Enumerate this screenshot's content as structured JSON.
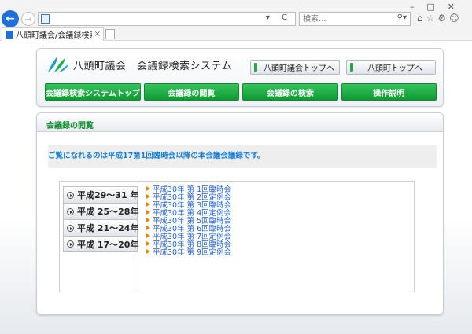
{
  "browser": {
    "tab_title": "八頭町議会/会議録検索シス...",
    "search_placeholder": "検索...",
    "address_tools": "▾ C"
  },
  "header": {
    "title": "八頭町議会　会議録検索システム",
    "top_links": [
      "八頭町議会トップへ",
      "八頭町トップへ"
    ],
    "menu": [
      "会議録検索システムトップ",
      "会議録の閲覧",
      "会議録の検索",
      "操作説明"
    ]
  },
  "content": {
    "section_title": "会議録の閲覧",
    "notice": "ご覧になれるのは平成17第1回臨時会以降の本会議会議録です。",
    "eras": [
      "平成29～31 年",
      "平成 25～28年",
      "平成 21～24年",
      "平成 17～20年"
    ],
    "meetings": [
      "平成30年 第 1回臨時会",
      "平成30年 第 2回定例会",
      "平成30年 第 3回臨時会",
      "平成30年 第 4回定例会",
      "平成30年 第 5回臨時会",
      "平成30年 第 6回臨時会",
      "平成30年 第 7回定例会",
      "平成30年 第 8回臨時会",
      "平成30年 第 9回定例会"
    ]
  },
  "colors": {
    "accent_green": "#0f9a34",
    "link_blue": "#1f5fd8",
    "notice_blue": "#1a7fd0",
    "bullet_orange": "#e58a00"
  }
}
